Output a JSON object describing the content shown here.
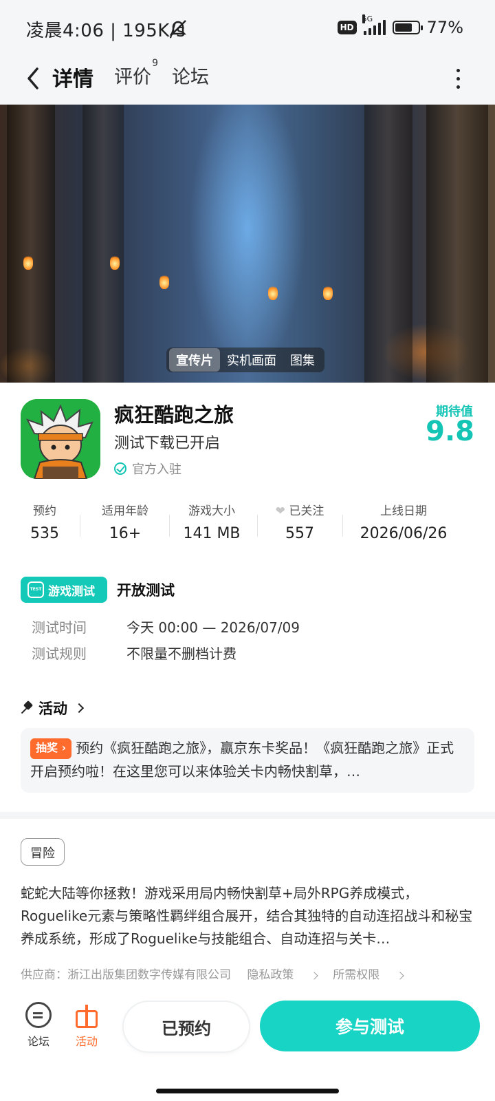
{
  "status_bar": {
    "time_speed": "凌晨4:06 | 195K/s",
    "hd": "HD",
    "network": "5G",
    "battery": "77%",
    "battery_level": 0.77
  },
  "nav": {
    "tabs": [
      {
        "label": "详情",
        "active": true
      },
      {
        "label": "评价",
        "badge": "9"
      },
      {
        "label": "论坛"
      }
    ]
  },
  "hero": {
    "media_tabs": [
      "宣传片",
      "实机画面",
      "图集"
    ],
    "active_tab": "宣传片"
  },
  "game": {
    "title": "疯狂酷跑之旅",
    "subtitle": "测试下载已开启",
    "official": "官方入驻",
    "expect_label": "期待值",
    "expect_value": "9.8",
    "accent_color": "#14c5b6"
  },
  "stats": [
    {
      "label": "预约",
      "value": "535"
    },
    {
      "label": "适用年龄",
      "value": "16+"
    },
    {
      "label": "游戏大小",
      "value": "141 MB"
    },
    {
      "label": "已关注",
      "value": "557"
    },
    {
      "label": "上线日期",
      "value": "2026/06/26"
    }
  ],
  "test": {
    "badge": "游戏测试",
    "badge_icon_text": "TEST",
    "type": "开放测试",
    "rows": [
      {
        "label": "测试时间",
        "value": "今天 00:00 — 2026/07/09"
      },
      {
        "label": "测试规则",
        "value": "不限量不删档计费"
      }
    ]
  },
  "activity": {
    "heading": "活动",
    "tag": "抽奖",
    "text": "预约《疯狂酷跑之旅》，赢京东卡奖品！《疯狂酷跑之旅》正式开启预约啦！在这里您可以来体验关卡内畅快割草，…",
    "tag_color": "#ff6b2c"
  },
  "description": {
    "genre": "冒险",
    "text": "蛇蛇大陆等你拯救！游戏采用局内畅快割草+局外RPG养成模式，Roguelike元素与策略性羁绊组合展开，结合其独特的自动连招战斗和秘宝养成系统，形成了Roguelike与技能组合、自动连招与关卡…",
    "vendor": "供应商：浙江出版集团数字传媒有限公司",
    "privacy": "隐私政策",
    "permissions": "所需权限"
  },
  "bottom_bar": {
    "forum": "论坛",
    "activity": "活动",
    "reserved": "已预约",
    "join": "参与测试"
  }
}
